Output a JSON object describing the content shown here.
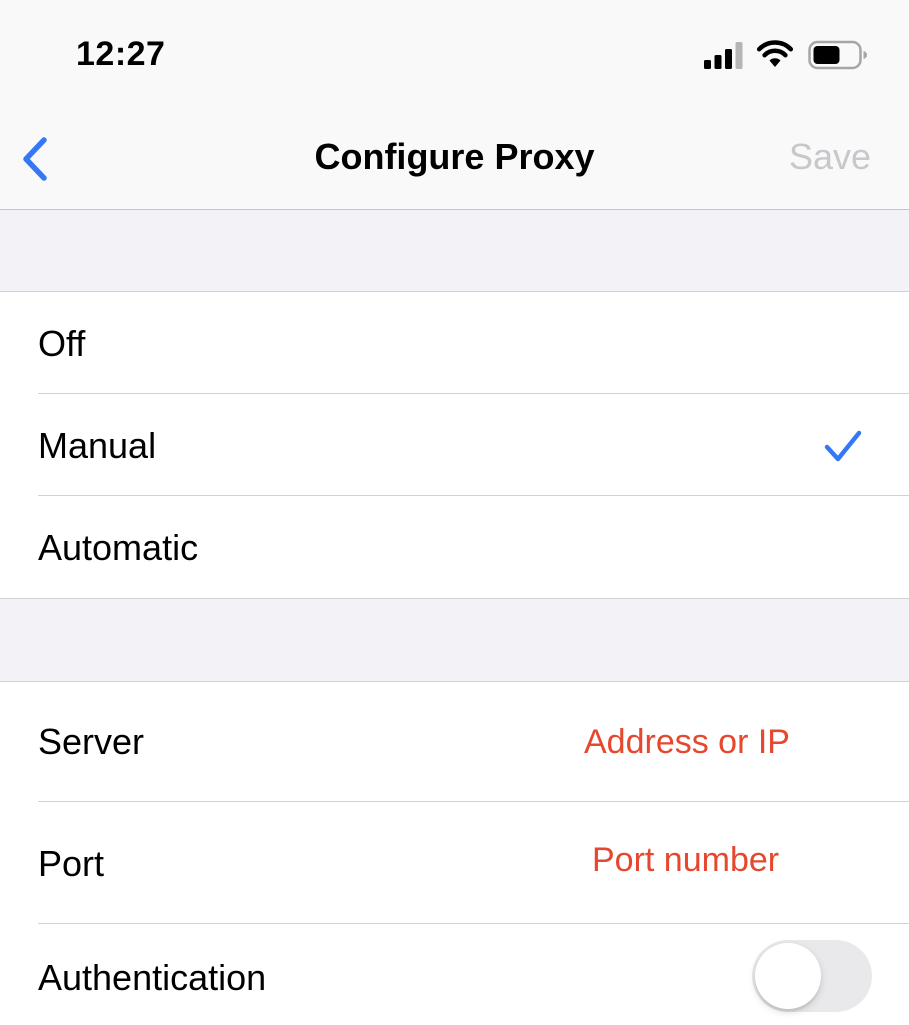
{
  "status_bar": {
    "time": "12:27"
  },
  "nav": {
    "title": "Configure Proxy",
    "save_label": "Save",
    "back_icon": "chevron-left-icon"
  },
  "proxy_modes": {
    "options": [
      {
        "label": "Off",
        "selected": false
      },
      {
        "label": "Manual",
        "selected": true
      },
      {
        "label": "Automatic",
        "selected": false
      }
    ]
  },
  "fields": {
    "server": {
      "label": "Server",
      "value": "",
      "placeholder": "Address or IP"
    },
    "port": {
      "label": "Port",
      "value": "",
      "placeholder": "Port number"
    },
    "authentication": {
      "label": "Authentication",
      "enabled": false
    }
  },
  "colors": {
    "accent": "#3478f6",
    "placeholder": "#e5472f",
    "save_disabled": "#c7c7cc",
    "background": "#f2f2f7"
  }
}
